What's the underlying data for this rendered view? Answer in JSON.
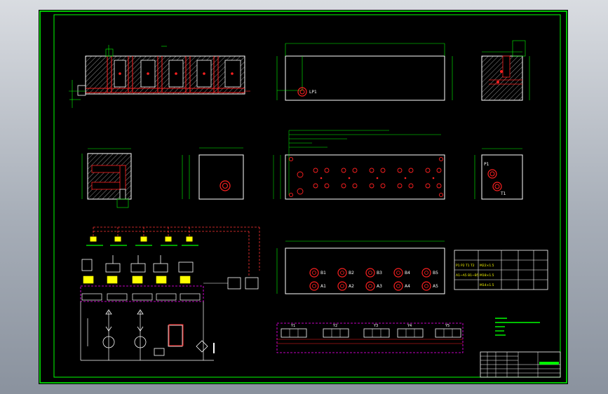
{
  "drawing": {
    "colors": {
      "background": "#000000",
      "frame": "#00ff00",
      "outline": "#ffffff",
      "dimension": "#00ff00",
      "centerline": "#ff2020",
      "hatch": "#9a9a9a",
      "port": "#ff2020",
      "valve": "#ffff00",
      "circuit": "#ff3333",
      "symbol": "#ffffff",
      "dashed_box": "#ff00ff"
    },
    "port_labels_bottom_row": [
      "B1",
      "B2",
      "B3",
      "B4",
      "B5"
    ],
    "port_labels_top_row": [
      "A1",
      "A2",
      "A3",
      "A4",
      "A5"
    ],
    "valve_bank_labels": [
      "Y1",
      "Y2",
      "Y3",
      "Y4",
      "Y5"
    ],
    "side_port_labels": [
      "P1",
      "T1"
    ],
    "front_port_label": "LP1",
    "param_table": {
      "rows": [
        [
          "",
          "",
          "",
          "",
          ""
        ],
        [
          "P1 P2 T1 T2",
          "M22×1.5",
          "",
          "",
          ""
        ],
        [
          "A1~A5 B1~B5",
          "M18×1.5",
          "",
          "",
          ""
        ],
        [
          "",
          "M14×1.5",
          "",
          "",
          ""
        ]
      ]
    },
    "title_block_label": "",
    "scale_mark": "1:1"
  }
}
